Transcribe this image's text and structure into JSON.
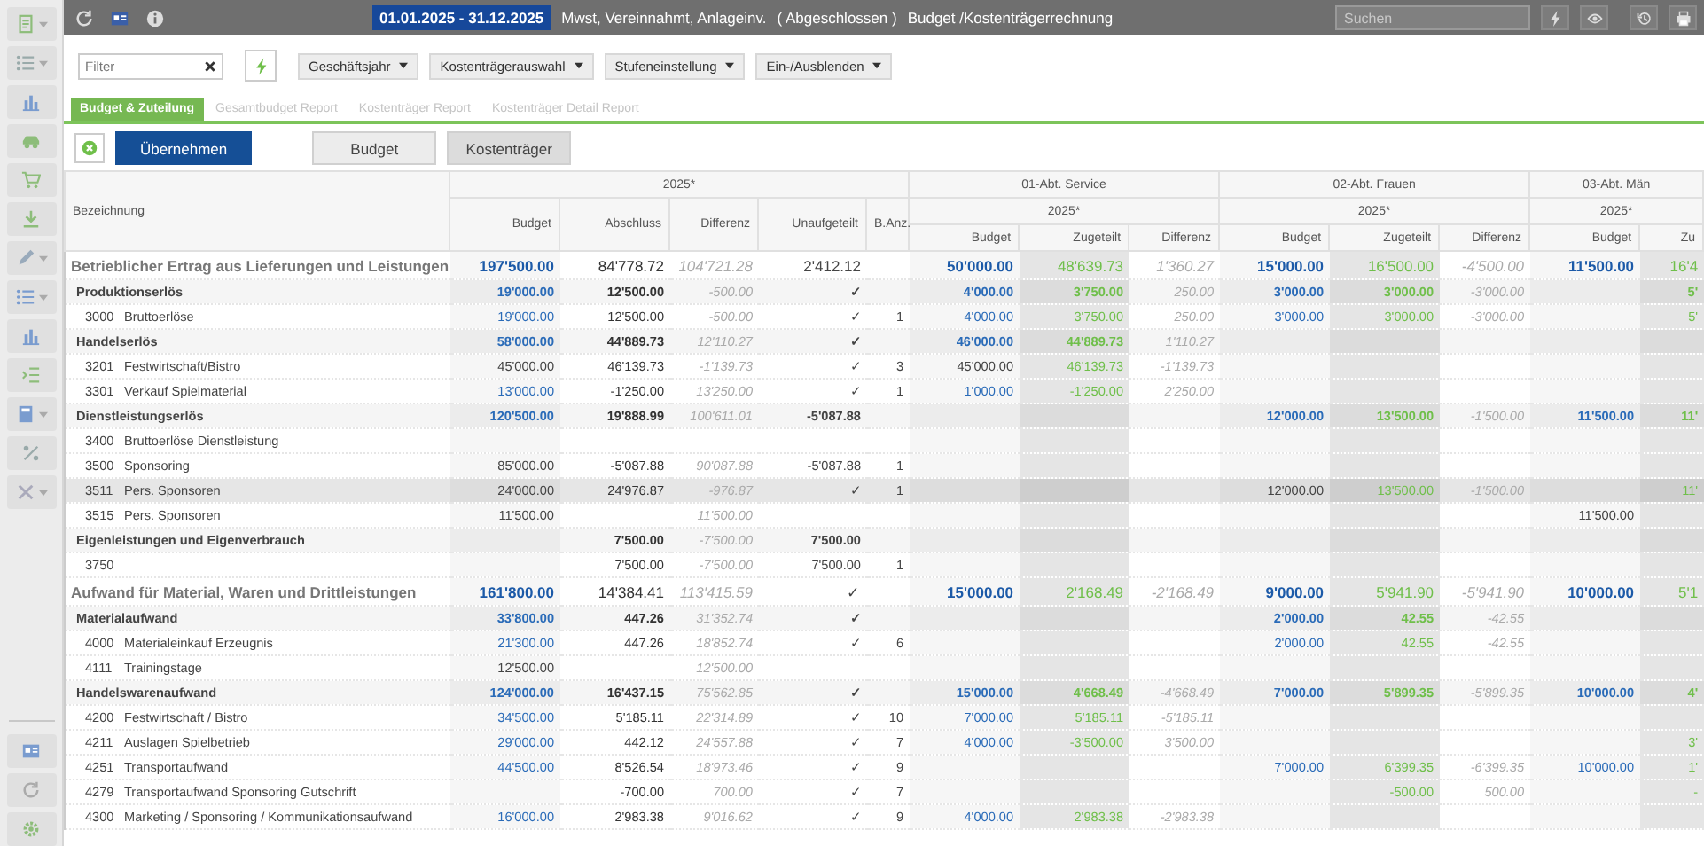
{
  "topbar": {
    "date_range": "01.01.2025 - 31.12.2025",
    "info": "Mwst, Vereinnahmt, Anlageinv.",
    "status": "( Abgeschlossen )",
    "module": "Budget /Kostenträgerrechnung",
    "search": {
      "placeholder": "Suchen"
    }
  },
  "toolbar": {
    "filter": {
      "placeholder": "Filter"
    },
    "dropdowns": [
      "Geschäftsjahr",
      "Kostenträgerauswahl",
      "Stufeneinstellung",
      "Ein-/Ausblenden"
    ]
  },
  "tabs": [
    {
      "label": "Budget & Zuteilung",
      "selected": true,
      "disabled": false
    },
    {
      "label": "Gesamtbudget Report",
      "selected": false,
      "disabled": true
    },
    {
      "label": "Kostenträger Report",
      "selected": false,
      "disabled": true
    },
    {
      "label": "Kostenträger Detail Report",
      "selected": false,
      "disabled": true
    }
  ],
  "actions": {
    "apply": "Übernehmen",
    "views": [
      {
        "label": "Budget",
        "selected": false
      },
      {
        "label": "Kostenträger",
        "selected": true
      }
    ]
  },
  "table": {
    "label_header": "Bezeichnung",
    "year": "2025*",
    "columns": [
      "Budget",
      "Abschluss",
      "Differenz",
      "Unaufgeteilt",
      "B.Anz."
    ],
    "departments": [
      {
        "name": "01-Abt. Service",
        "year": "2025*",
        "columns": [
          "Budget",
          "Zugeteilt",
          "Differenz"
        ]
      },
      {
        "name": "02-Abt. Frauen",
        "year": "2025*",
        "columns": [
          "Budget",
          "Zugeteilt",
          "Differenz"
        ]
      },
      {
        "name": "03-Abt. Män",
        "year": "2025*",
        "columns": [
          "Budget",
          "Zu"
        ]
      }
    ],
    "rows": [
      {
        "kind": "total",
        "label": "Betrieblicher Ertrag aus Lieferungen und Leistungen",
        "selected": false,
        "budget_linked": true,
        "cells": {
          "budget": "197'500.00",
          "actual": "84'778.72",
          "difference": "104'721.28",
          "unassigned": "2'412.12"
        },
        "dept_1": {
          "budget": "50'000.00",
          "allocated": "48'639.73",
          "difference": "1'360.27"
        },
        "dept_2": {
          "budget": "15'000.00",
          "allocated": "16'500.00",
          "difference": "-4'500.00"
        },
        "dept_3": {
          "budget": "11'500.00",
          "allocated": "16'4"
        }
      },
      {
        "kind": "group",
        "label": "Produktionserlös",
        "selected": false,
        "budget_linked": true,
        "cells": {
          "budget": "19'000.00",
          "actual": "12'500.00",
          "difference": "-500.00",
          "unassigned": "✓"
        },
        "dept_1": {
          "budget": "4'000.00",
          "allocated": "3'750.00",
          "difference": "250.00"
        },
        "dept_2": {
          "budget": "3'000.00",
          "allocated": "3'000.00",
          "difference": "-3'000.00"
        },
        "dept_3": {
          "allocated": "5'"
        }
      },
      {
        "kind": "account",
        "number": "3000",
        "label": "Bruttoerlöse",
        "selected": false,
        "budget_linked": true,
        "cells": {
          "budget": "19'000.00",
          "actual": "12'500.00",
          "difference": "-500.00",
          "unassigned": "✓",
          "count": "1"
        },
        "dept_1": {
          "budget": "4'000.00",
          "allocated": "3'750.00",
          "difference": "250.00"
        },
        "dept_2": {
          "budget": "3'000.00",
          "allocated": "3'000.00",
          "difference": "-3'000.00"
        },
        "dept_3": {
          "allocated": "5'"
        }
      },
      {
        "kind": "group",
        "label": "Handelserlös",
        "selected": false,
        "budget_linked": true,
        "cells": {
          "budget": "58'000.00",
          "actual": "44'889.73",
          "difference": "12'110.27",
          "unassigned": "✓"
        },
        "dept_1": {
          "budget": "46'000.00",
          "allocated": "44'889.73",
          "difference": "1'110.27"
        }
      },
      {
        "kind": "account",
        "number": "3201",
        "label": "Festwirtschaft/Bistro",
        "selected": false,
        "budget_linked": false,
        "cells": {
          "budget": "45'000.00",
          "actual": "46'139.73",
          "difference": "-1'139.73",
          "unassigned": "✓",
          "count": "3"
        },
        "dept_1": {
          "budget": "45'000.00",
          "allocated": "46'139.73",
          "difference": "-1'139.73"
        }
      },
      {
        "kind": "account",
        "number": "3301",
        "label": "Verkauf Spielmaterial",
        "selected": false,
        "budget_linked": true,
        "cells": {
          "budget": "13'000.00",
          "actual": "-1'250.00",
          "difference": "13'250.00",
          "unassigned": "✓",
          "count": "1"
        },
        "dept_1": {
          "budget": "1'000.00",
          "allocated": "-1'250.00",
          "difference": "2'250.00"
        }
      },
      {
        "kind": "group",
        "label": "Dienstleistungserlös",
        "selected": false,
        "budget_linked": true,
        "cells": {
          "budget": "120'500.00",
          "actual": "19'888.99",
          "difference": "100'611.01",
          "unassigned": "-5'087.88"
        },
        "dept_2": {
          "budget": "12'000.00",
          "allocated": "13'500.00",
          "difference": "-1'500.00"
        },
        "dept_3": {
          "budget": "11'500.00",
          "allocated": "11'"
        }
      },
      {
        "kind": "account",
        "number": "3400",
        "label": "Bruttoerlöse Dienstleistung",
        "selected": false
      },
      {
        "kind": "account",
        "number": "3500",
        "label": "Sponsoring",
        "selected": false,
        "budget_linked": false,
        "cells": {
          "budget": "85'000.00",
          "actual": "-5'087.88",
          "difference": "90'087.88",
          "unassigned": "-5'087.88",
          "count": "1"
        }
      },
      {
        "kind": "account",
        "number": "3511",
        "label": "Pers. Sponsoren",
        "selected": true,
        "budget_linked": false,
        "cells": {
          "budget": "24'000.00",
          "actual": "24'976.87",
          "difference": "-976.87",
          "unassigned": "✓",
          "count": "1"
        },
        "dept_2": {
          "budget": "12'000.00",
          "allocated": "13'500.00",
          "difference": "-1'500.00"
        },
        "dept_3": {
          "allocated": "11'"
        }
      },
      {
        "kind": "account",
        "number": "3515",
        "label": "Pers. Sponsoren",
        "selected": false,
        "budget_linked": false,
        "cells": {
          "budget": "11'500.00",
          "difference": "11'500.00"
        },
        "dept_3": {
          "budget": "11'500.00"
        }
      },
      {
        "kind": "group",
        "label": "Eigenleistungen und Eigenverbrauch",
        "selected": false,
        "cells": {
          "actual": "7'500.00",
          "difference": "-7'500.00",
          "unassigned": "7'500.00"
        }
      },
      {
        "kind": "account",
        "number": "3750",
        "selected": false,
        "cells": {
          "actual": "7'500.00",
          "difference": "-7'500.00",
          "unassigned": "7'500.00",
          "count": "1"
        }
      },
      {
        "kind": "total",
        "label": "Aufwand für Material, Waren und Drittleistungen",
        "selected": false,
        "budget_linked": true,
        "cells": {
          "budget": "161'800.00",
          "actual": "14'384.41",
          "difference": "113'415.59",
          "unassigned": "✓"
        },
        "dept_1": {
          "budget": "15'000.00",
          "allocated": "2'168.49",
          "difference": "-2'168.49"
        },
        "dept_2": {
          "budget": "9'000.00",
          "allocated": "5'941.90",
          "difference": "-5'941.90"
        },
        "dept_3": {
          "budget": "10'000.00",
          "allocated": "5'1"
        }
      },
      {
        "kind": "group",
        "label": "Materialaufwand",
        "selected": false,
        "budget_linked": true,
        "cells": {
          "budget": "33'800.00",
          "actual": "447.26",
          "difference": "31'352.74",
          "unassigned": "✓"
        },
        "dept_2": {
          "budget": "2'000.00",
          "allocated": "42.55",
          "difference": "-42.55"
        }
      },
      {
        "kind": "account",
        "number": "4000",
        "label": "Materialeinkauf Erzeugnis",
        "selected": false,
        "budget_linked": true,
        "cells": {
          "budget": "21'300.00",
          "actual": "447.26",
          "difference": "18'852.74",
          "unassigned": "✓",
          "count": "6"
        },
        "dept_2": {
          "budget": "2'000.00",
          "allocated": "42.55",
          "difference": "-42.55"
        }
      },
      {
        "kind": "account",
        "number": "4111",
        "label": "Trainingstage",
        "selected": false,
        "budget_linked": false,
        "cells": {
          "budget": "12'500.00",
          "difference": "12'500.00"
        }
      },
      {
        "kind": "group",
        "label": "Handelswarenaufwand",
        "selected": false,
        "budget_linked": true,
        "cells": {
          "budget": "124'000.00",
          "actual": "16'437.15",
          "difference": "75'562.85",
          "unassigned": "✓"
        },
        "dept_1": {
          "budget": "15'000.00",
          "allocated": "4'668.49",
          "difference": "-4'668.49"
        },
        "dept_2": {
          "budget": "7'000.00",
          "allocated": "5'899.35",
          "difference": "-5'899.35"
        },
        "dept_3": {
          "budget": "10'000.00",
          "allocated": "4'"
        }
      },
      {
        "kind": "account",
        "number": "4200",
        "label": "Festwirtschaft / Bistro",
        "selected": false,
        "budget_linked": true,
        "cells": {
          "budget": "34'500.00",
          "actual": "5'185.11",
          "difference": "22'314.89",
          "unassigned": "✓",
          "count": "10"
        },
        "dept_1": {
          "budget": "7'000.00",
          "allocated": "5'185.11",
          "difference": "-5'185.11"
        }
      },
      {
        "kind": "account",
        "number": "4211",
        "label": "Auslagen Spielbetrieb",
        "selected": false,
        "budget_linked": true,
        "cells": {
          "budget": "29'000.00",
          "actual": "442.12",
          "difference": "24'557.88",
          "unassigned": "✓",
          "count": "7"
        },
        "dept_1": {
          "budget": "4'000.00",
          "allocated": "-3'500.00",
          "difference": "3'500.00"
        },
        "dept_3": {
          "allocated": "3'"
        }
      },
      {
        "kind": "account",
        "number": "4251",
        "label": "Transportaufwand",
        "selected": false,
        "budget_linked": true,
        "cells": {
          "budget": "44'500.00",
          "actual": "8'526.54",
          "difference": "18'973.46",
          "unassigned": "✓",
          "count": "9"
        },
        "dept_2": {
          "budget": "7'000.00",
          "allocated": "6'399.35",
          "difference": "-6'399.35"
        },
        "dept_3": {
          "budget": "10'000.00",
          "allocated": "1'"
        }
      },
      {
        "kind": "account",
        "number": "4279",
        "label": "Transportaufwand Sponsoring Gutschrift",
        "selected": false,
        "cells": {
          "actual": "-700.00",
          "difference": "700.00",
          "unassigned": "✓",
          "count": "7"
        },
        "dept_2": {
          "allocated": "-500.00",
          "difference": "500.00"
        },
        "dept_3": {
          "allocated": "-"
        }
      },
      {
        "kind": "account",
        "number": "4300",
        "label": "Marketing / Sponsoring / Kommunikationsaufwand",
        "selected": false,
        "budget_linked": true,
        "cells": {
          "budget": "16'000.00",
          "actual": "2'983.38",
          "difference": "9'016.62",
          "unassigned": "✓",
          "count": "9"
        },
        "dept_1": {
          "budget": "4'000.00",
          "allocated": "2'983.38",
          "difference": "-2'983.38"
        }
      }
    ]
  }
}
